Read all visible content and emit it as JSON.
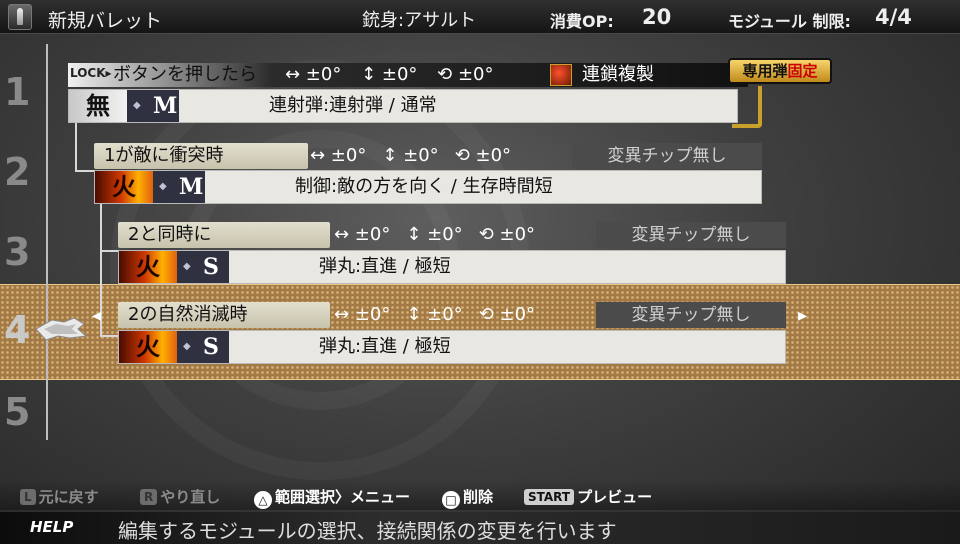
{
  "header": {
    "title": "新規バレット",
    "gun": "銃身:アサルト",
    "op_label": "消費OP:",
    "op_value": "20",
    "module_label": "モジュール 制限:",
    "module_value": "4/4"
  },
  "levels": [
    "1",
    "2",
    "3",
    "4",
    "5"
  ],
  "selected_level": 4,
  "lock": {
    "tag": "LOCK▸",
    "trigger": "ボタンを押したら",
    "stats": [
      "↔ ±0°",
      "↕ ±0°",
      "⟲ ±0°"
    ],
    "chain": "連鎖複製",
    "badge_a": "専用弾",
    "badge_b": "固定"
  },
  "modules": [
    {
      "element": "無",
      "size": "M",
      "desc": "連射弾:連射弾 / 通常"
    },
    {
      "condition": "1が敵に衝突時",
      "stats": [
        "↔ ±0°",
        "↕ ±0°",
        "⟲ ±0°"
      ],
      "chip": "変異チップ無し",
      "element": "火",
      "size": "M",
      "desc": "制御:敵の方を向く / 生存時間短"
    },
    {
      "condition": "2と同時に",
      "stats": [
        "↔ ±0°",
        "↕ ±0°",
        "⟲ ±0°"
      ],
      "chip": "変異チップ無し",
      "element": "火",
      "size": "S",
      "desc": "弾丸:直進 / 極短"
    },
    {
      "condition": "2の自然消滅時",
      "stats": [
        "↔ ±0°",
        "↕ ±0°",
        "⟲ ±0°"
      ],
      "chip": "変異チップ無し",
      "element": "火",
      "size": "S",
      "desc": "弾丸:直進 / 極短"
    }
  ],
  "nav": {
    "left": "◂",
    "right": "▸"
  },
  "buttons": {
    "l_glyph": "L",
    "l_label": "元に戻す",
    "r_glyph": "R",
    "r_label": "やり直し",
    "tri_glyph": "△",
    "tri_label": "範囲選択〉メニュー",
    "sq_glyph": "□",
    "sq_label": "削除",
    "start_glyph": "START",
    "start_label": "プレビュー"
  },
  "help": {
    "label": "HELP",
    "text": "編集するモジュールの選択、接続関係の変更を行います"
  },
  "colors": {
    "accent_gold": "#c9a02c",
    "select_band": "#a37a46",
    "fire": "#d03800"
  }
}
